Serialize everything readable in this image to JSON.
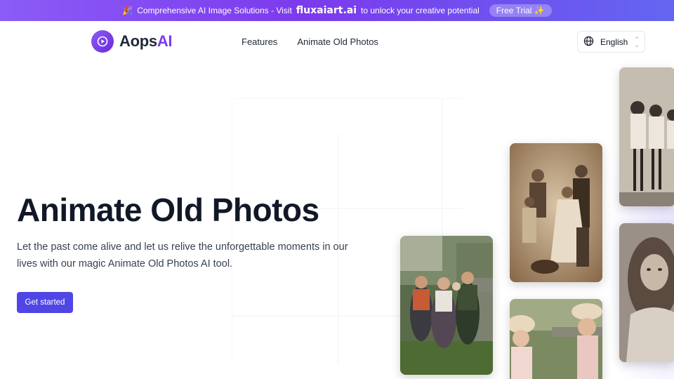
{
  "banner": {
    "emoji": "🎉",
    "text_before": "Comprehensive AI Image Solutions - Visit",
    "brand_link": "fluxaiart.ai",
    "text_after": "to unlock your creative potential",
    "trial_label": "Free Trial ✨"
  },
  "header": {
    "logo_text": "Aops",
    "logo_accent": "AI",
    "nav": [
      "Features",
      "Animate Old Photos"
    ],
    "language": "English"
  },
  "hero": {
    "title": "Animate Old Photos",
    "description": "Let the past come alive and let us relive the unforgettable moments in our lives with our magic Animate Old Photos AI tool.",
    "cta_label": "Get started"
  },
  "colors": {
    "banner_start": "#8b5cf6",
    "banner_end": "#6366f1",
    "accent": "#7c3aed",
    "cta": "#4f46e5"
  },
  "icons": [
    "party-icon",
    "logo-play-icon",
    "globe-icon",
    "chevron-updown-icon"
  ]
}
